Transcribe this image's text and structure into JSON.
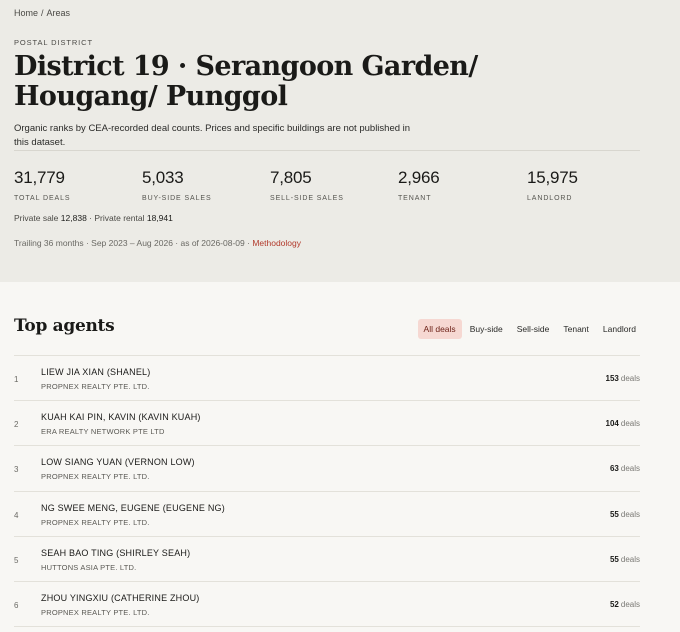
{
  "breadcrumb": {
    "home": "Home",
    "separator": "/",
    "current": "Areas"
  },
  "eyebrow": "POSTAL DISTRICT",
  "title": "District 19 · Serangoon Garden/ Hougang/ Punggol",
  "lede": "Organic ranks by CEA-recorded deal counts. Prices and specific buildings are not published in this dataset.",
  "stats": [
    {
      "value": "31,779",
      "label": "TOTAL DEALS"
    },
    {
      "value": "5,033",
      "label": "BUY-SIDE SALES"
    },
    {
      "value": "7,805",
      "label": "SELL-SIDE SALES"
    },
    {
      "value": "2,966",
      "label": "TENANT"
    },
    {
      "value": "15,975",
      "label": "LANDLORD"
    }
  ],
  "sub": {
    "sale_label": "Private sale",
    "sale_value": "12,838",
    "sep": "·",
    "rental_label": "Private rental",
    "rental_value": "18,941"
  },
  "trail": {
    "text": "Trailing 36 months · Sep 2023 – Aug 2026 · as of 2026-08-09 ·",
    "link": "Methodology"
  },
  "agents": {
    "heading": "Top agents",
    "tabs": [
      "All deals",
      "Buy-side",
      "Sell-side",
      "Tenant",
      "Landlord"
    ],
    "active_tab": "All deals",
    "unit": "deals",
    "rows": [
      {
        "rank": "1",
        "name": "LIEW JIA XIAN (SHANEL)",
        "agency": "PROPNEX REALTY PTE. LTD.",
        "deals": "153"
      },
      {
        "rank": "2",
        "name": "KUAH KAI PIN, KAVIN (KAVIN KUAH)",
        "agency": "ERA REALTY NETWORK PTE LTD",
        "deals": "104"
      },
      {
        "rank": "3",
        "name": "LOW SIANG YUAN (VERNON LOW)",
        "agency": "PROPNEX REALTY PTE. LTD.",
        "deals": "63"
      },
      {
        "rank": "4",
        "name": "NG SWEE MENG, EUGENE (EUGENE NG)",
        "agency": "PROPNEX REALTY PTE. LTD.",
        "deals": "55"
      },
      {
        "rank": "5",
        "name": "SEAH BAO TING (SHIRLEY SEAH)",
        "agency": "HUTTONS ASIA PTE. LTD.",
        "deals": "55"
      },
      {
        "rank": "6",
        "name": "ZHOU YINGXIU (CATHERINE ZHOU)",
        "agency": "PROPNEX REALTY PTE. LTD.",
        "deals": "52"
      }
    ]
  },
  "colors": {
    "hero_bg": "#ecebe6",
    "page_bg": "#f8f7f4",
    "accent": "#b23a2c",
    "active_tab_bg": "#f6d8d2"
  }
}
